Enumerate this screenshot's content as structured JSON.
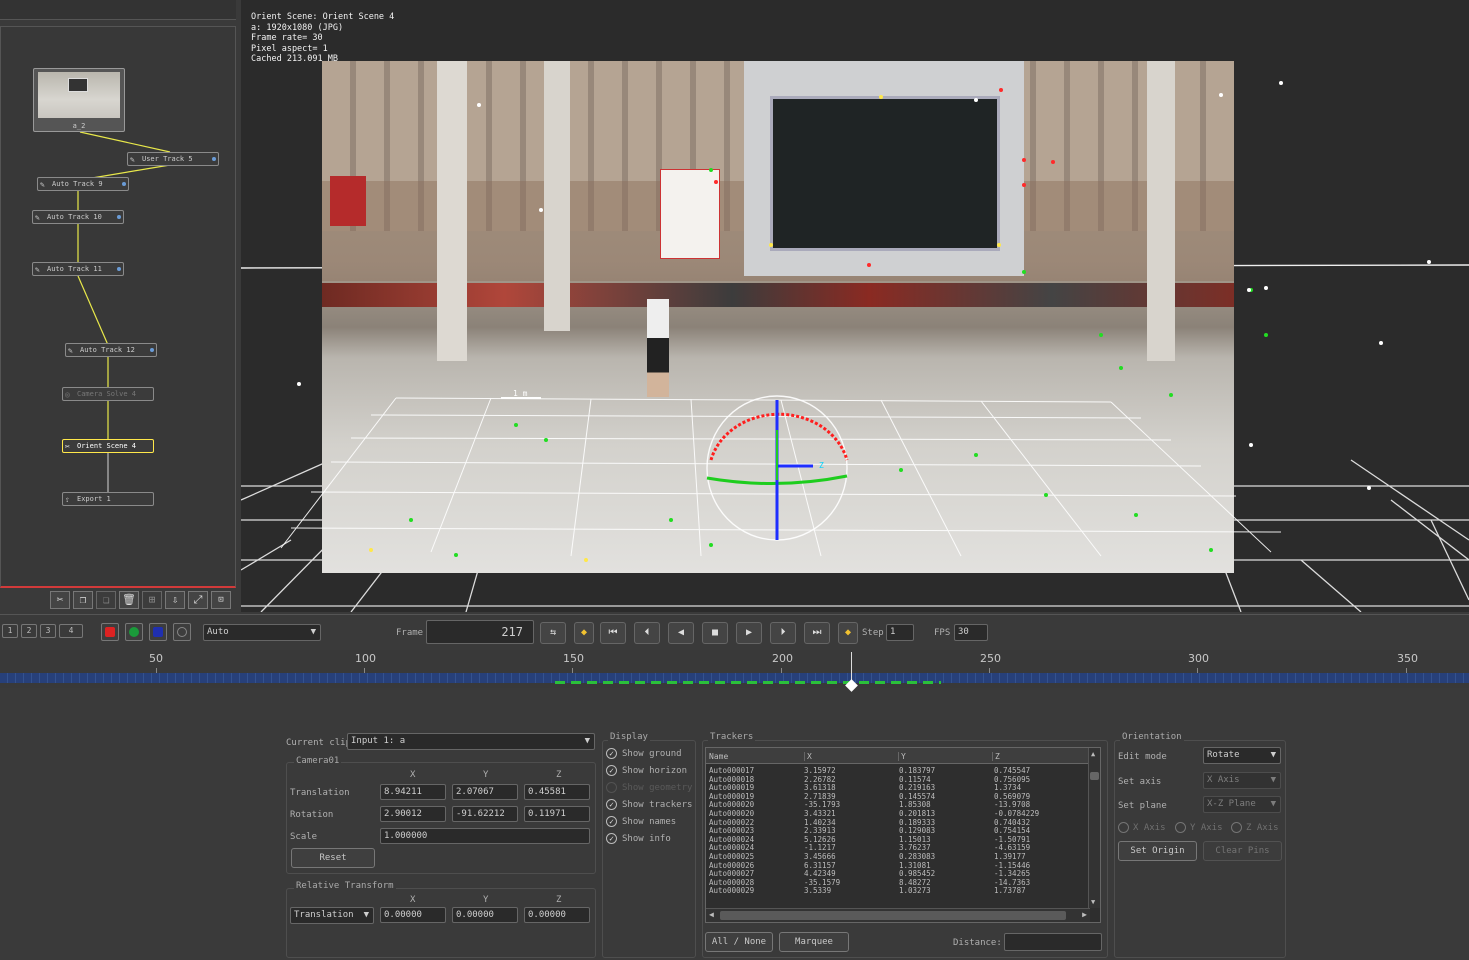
{
  "info": {
    "line1": "Orient Scene: Orient Scene 4",
    "line2": "a: 1920x1080 (JPG)",
    "line3": "Frame rate= 30",
    "line4": "Pixel aspect= 1",
    "line5": "Cached 213.091 MB"
  },
  "viewport": {
    "scale_label": "1 m",
    "colors": {
      "x_axis": "#ff1e1e",
      "y_axis": "#1ecd1e",
      "z_axis": "#1e2eff",
      "ground": "#ffffff",
      "names": "#00d4ff"
    }
  },
  "nodes": [
    {
      "label": "a_2",
      "icon": "image-thumbnail-icon"
    },
    {
      "label": "User Track 5",
      "icon": "user-track-icon"
    },
    {
      "label": "Auto Track 9",
      "icon": "auto-track-icon"
    },
    {
      "label": "Auto Track 10",
      "icon": "auto-track-icon"
    },
    {
      "label": "Auto Track 11",
      "icon": "auto-track-icon"
    },
    {
      "label": "Auto Track 12",
      "icon": "auto-track-icon"
    },
    {
      "label": "Camera Solve 4",
      "icon": "camera-solve-icon"
    },
    {
      "label": "Orient Scene 4",
      "icon": "orient-icon"
    },
    {
      "label": "Export 1",
      "icon": "export-icon"
    }
  ],
  "views": [
    "1",
    "2",
    "3",
    "4"
  ],
  "colors_selector": {
    "value": "Auto"
  },
  "transport": {
    "frame_label": "Frame",
    "frame": "217",
    "step_label": "Step",
    "step": "1",
    "fps_label": "FPS",
    "fps": "30"
  },
  "timeline": {
    "ticks": [
      "50",
      "100",
      "150",
      "200",
      "250",
      "300",
      "350"
    ],
    "current": 217
  },
  "clip": {
    "label": "Current clip",
    "value": "Input 1: a",
    "camera_title": "Camera01",
    "x": "X",
    "y": "Y",
    "z": "Z",
    "translation_label": "Translation",
    "translation": [
      "8.94211",
      "2.07067",
      "0.45581"
    ],
    "rotation_label": "Rotation",
    "rotation": [
      "2.90012",
      "-91.62212",
      "0.11971"
    ],
    "scale_label": "Scale",
    "scale": "1.000000",
    "reset": "Reset",
    "relative_title": "Relative Transform",
    "relative_mode": "Translation",
    "relative": [
      "0.00000",
      "0.00000",
      "0.00000"
    ]
  },
  "display": {
    "title": "Display",
    "items": [
      {
        "label": "Show ground",
        "checked": true
      },
      {
        "label": "Show horizon",
        "checked": true
      },
      {
        "label": "Show geometry",
        "checked": false
      },
      {
        "label": "Show trackers",
        "checked": true
      },
      {
        "label": "Show names",
        "checked": true
      },
      {
        "label": "Show info",
        "checked": true
      }
    ]
  },
  "trackers": {
    "title": "Trackers",
    "headers": [
      "Name",
      "X",
      "Y",
      "Z"
    ],
    "rows": [
      [
        "Auto000017",
        "3.15972",
        "0.183797",
        "0.745547"
      ],
      [
        "Auto000018",
        "2.26782",
        "0.11574",
        "0.756095"
      ],
      [
        "Auto000019",
        "3.61318",
        "0.219163",
        "1.3734"
      ],
      [
        "Auto000019",
        "2.71839",
        "0.145574",
        "0.569079"
      ],
      [
        "Auto000020",
        "-35.1793",
        "1.85308",
        "-13.9708"
      ],
      [
        "Auto000020",
        "3.43321",
        "0.201813",
        "-0.0784229"
      ],
      [
        "Auto000022",
        "1.40234",
        "0.189333",
        "0.740432"
      ],
      [
        "Auto000023",
        "2.33913",
        "0.129083",
        "0.754154"
      ],
      [
        "Auto000024",
        "5.12626",
        "1.15013",
        "-1.50791"
      ],
      [
        "Auto000024",
        "-1.1217",
        "3.76237",
        "-4.63159"
      ],
      [
        "Auto000025",
        "3.45666",
        "0.283083",
        "1.39177"
      ],
      [
        "Auto000026",
        "6.31157",
        "1.31081",
        "-1.15446"
      ],
      [
        "Auto000027",
        "4.42349",
        "0.985452",
        "-1.34265"
      ],
      [
        "Auto000028",
        "-35.1579",
        "8.48272",
        "-14.7363"
      ],
      [
        "Auto000029",
        "3.5339",
        "1.03273",
        "1.73787"
      ]
    ],
    "all_none": "All / None",
    "marquee": "Marquee",
    "distance_label": "Distance:",
    "distance": ""
  },
  "orientation": {
    "title": "Orientation",
    "edit_mode_label": "Edit mode",
    "edit_mode": "Rotate",
    "set_axis_label": "Set axis",
    "set_axis": "X Axis",
    "set_plane_label": "Set plane",
    "set_plane": "X-Z Plane",
    "radios": [
      "X Axis",
      "Y Axis",
      "Z Axis"
    ],
    "set_origin": "Set Origin",
    "clear_pins": "Clear Pins"
  }
}
